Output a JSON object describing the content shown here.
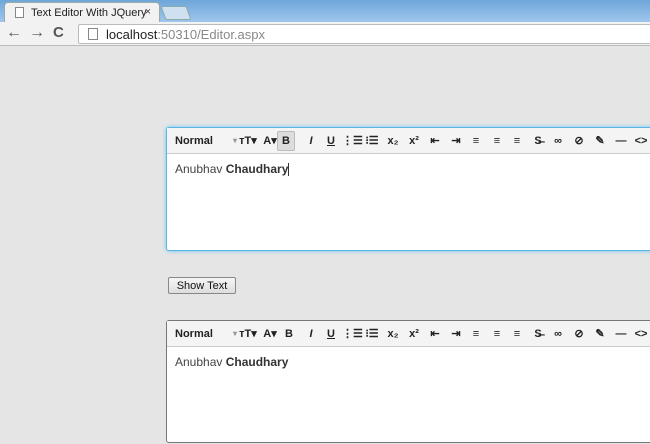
{
  "browser": {
    "tab_title": "Text Editor With JQuery",
    "close": "×",
    "url_host": "localhost",
    "url_rest": ":50310/Editor.aspx",
    "back": "←",
    "forward": "→",
    "reload": "C"
  },
  "toolbar": [
    {
      "name": "format-select",
      "glyph": "Normal"
    },
    {
      "name": "format-caret",
      "glyph": "▾"
    },
    {
      "name": "font-size-button",
      "glyph": "тT▾"
    },
    {
      "name": "font-color-button",
      "glyph": "A▾"
    },
    {
      "name": "bold-button",
      "glyph": "B"
    },
    {
      "name": "italic-button",
      "glyph": "I"
    },
    {
      "name": "underline-button",
      "glyph": "U"
    },
    {
      "name": "ordered-list-button",
      "glyph": "⋮☰"
    },
    {
      "name": "unordered-list-button",
      "glyph": "⁝☰"
    },
    {
      "name": "subscript-button",
      "glyph": "x₂"
    },
    {
      "name": "superscript-button",
      "glyph": "x²"
    },
    {
      "name": "outdent-button",
      "glyph": "⇤"
    },
    {
      "name": "indent-button",
      "glyph": "⇥"
    },
    {
      "name": "align-left-button",
      "glyph": "≡"
    },
    {
      "name": "align-center-button",
      "glyph": "≡"
    },
    {
      "name": "align-right-button",
      "glyph": "≡"
    },
    {
      "name": "strikethrough-button",
      "glyph": "S̶"
    },
    {
      "name": "link-button",
      "glyph": "∞"
    },
    {
      "name": "unlink-button",
      "glyph": "⊘"
    },
    {
      "name": "eraser-button",
      "glyph": "✎"
    },
    {
      "name": "horizontal-rule-button",
      "glyph": "—"
    },
    {
      "name": "source-button",
      "glyph": "<>"
    }
  ],
  "editor1": {
    "text_normal": "Anubhav ",
    "text_bold": "Chaudhary"
  },
  "show_button": "Show Text",
  "editor2": {
    "text_normal": "Anubhav ",
    "text_bold": "Chaudhary"
  }
}
